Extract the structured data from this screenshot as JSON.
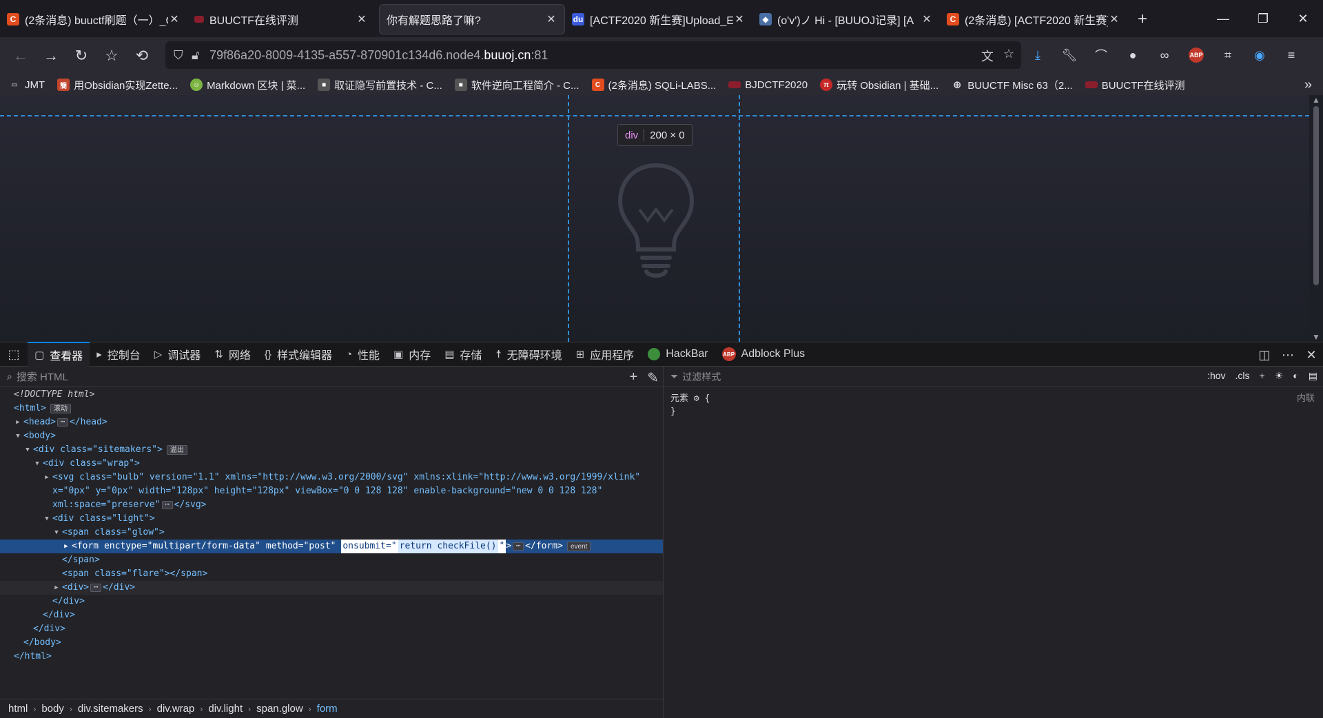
{
  "tabs": [
    {
      "title": "(2条消息) buuctf刷题（一）_C",
      "favicon": "C",
      "favcolor": "#e24c1e"
    },
    {
      "title": "BUUCTF在线评测",
      "favicon": "B",
      "favcolor": "#8b1d2c"
    },
    {
      "title": "你有解题思路了嘛?",
      "favicon": "",
      "favcolor": ""
    },
    {
      "title": "[ACTF2020 新生赛]Upload_E",
      "favicon": "du",
      "favcolor": "#3b5bdb"
    },
    {
      "title": "(o'v')ノ Hi - [BUUOJ记录] [A",
      "favicon": "◆",
      "favcolor": "#4a6fa5"
    },
    {
      "title": "(2条消息) [ACTF2020 新生赛]",
      "favicon": "C",
      "favcolor": "#e24c1e"
    }
  ],
  "url": {
    "prefix": "79f86a20-8009-4135-a557-870901c134d6.node4.",
    "host": "buuoj.cn",
    "suffix": ":81"
  },
  "bookmarks": [
    {
      "label": "JMT",
      "icon": "folder"
    },
    {
      "label": "用Obsidian实现Zette...",
      "icon": "簡"
    },
    {
      "label": "Markdown 区块 | 菜...",
      "icon": "☺"
    },
    {
      "label": "取证隐写前置技术 - C...",
      "icon": "■"
    },
    {
      "label": "软件逆向工程简介 - C...",
      "icon": "■"
    },
    {
      "label": "(2条消息) SQLi-LABS...",
      "icon": "C"
    },
    {
      "label": "BJDCTF2020",
      "icon": "≡"
    },
    {
      "label": "玩转 Obsidian | 基础...",
      "icon": "π"
    },
    {
      "label": "BUUCTF Misc 63（2...",
      "icon": "globe"
    },
    {
      "label": "BUUCTF在线评测",
      "icon": "≡"
    }
  ],
  "page": {
    "tooltip_tag": "div",
    "tooltip_dims": "200 × 0"
  },
  "devtools": {
    "tabs": [
      "查看器",
      "控制台",
      "调试器",
      "网络",
      "样式编辑器",
      "性能",
      "内存",
      "存储",
      "无障碍环境",
      "应用程序",
      "HackBar",
      "Adblock Plus"
    ],
    "active_tab": "查看器",
    "search_placeholder": "搜索 HTML",
    "filter_placeholder": "过滤样式",
    "hov": ":hov",
    "cls": ".cls",
    "element_rule": "元素",
    "brace_open": "{",
    "brace_close": "}",
    "inline_label": "内联"
  },
  "tree": {
    "doctype": "<!DOCTYPE html>",
    "html_open": "<html>",
    "html_badge": "滚动",
    "head": "<head>",
    "head_close": "</head>",
    "body_open": "<body>",
    "sitemakers_tag": "<div class=\"sitemakers\">",
    "sitemakers_badge": "溢出",
    "wrap_tag": "<div class=\"wrap\">",
    "svg_line1": "<svg class=\"bulb\" version=\"1.1\" xmlns=\"http://www.w3.org/2000/svg\" xmlns:xlink=\"http://www.w3.org/1999/xlink\"",
    "svg_line2": "x=\"0px\" y=\"0px\" width=\"128px\" height=\"128px\" viewBox=\"0 0 128 128\" enable-background=\"new 0 0 128 128\"",
    "svg_line3": "xml:space=\"preserve\"",
    "svg_close": "</svg>",
    "light_tag": "<div class=\"light\">",
    "glow_tag": "<span class=\"glow\">",
    "form_pre": "<form enctype=\"multipart/form-data\" method=\"post\" ",
    "form_onsubmit_attr": "onsubmit=\"",
    "form_onsubmit_val": "return checkFile()",
    "form_onsubmit_end": "\"",
    "form_post": ">",
    "form_close": "</form>",
    "form_badge": "event",
    "span_close": "</span>",
    "flare_tag": "<span class=\"flare\"></span>",
    "div_open": "<div>",
    "div_close_inline": "</div>",
    "div_close": "</div>",
    "body_close": "</body>",
    "html_close": "</html>"
  },
  "breadcrumbs": [
    "html",
    "body",
    "div.sitemakers",
    "div.wrap",
    "div.light",
    "span.glow",
    "form"
  ],
  "colors": {
    "accent": "#0a84ff",
    "highlight_dash": "#2f8fd8",
    "selected_row": "#204e8a"
  }
}
